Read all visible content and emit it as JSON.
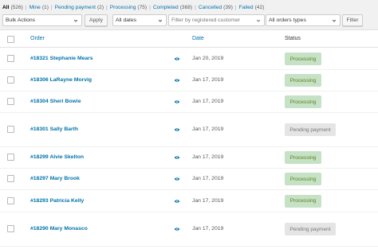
{
  "filters": [
    {
      "label": "All",
      "count": "(526)",
      "current": true
    },
    {
      "label": "Mine",
      "count": "(1)"
    },
    {
      "label": "Pending payment",
      "count": "(2)"
    },
    {
      "label": "Processing",
      "count": "(75)"
    },
    {
      "label": "Completed",
      "count": "(368)"
    },
    {
      "label": "Cancelled",
      "count": "(39)"
    },
    {
      "label": "Failed",
      "count": "(42)"
    }
  ],
  "toolbar": {
    "bulk_actions": "Bulk Actions",
    "apply_label": "Apply",
    "dates": "All dates",
    "customer_placeholder": "Filter by registered customer",
    "order_types": "All orders types",
    "filter_label": "Filter"
  },
  "table": {
    "columns": {
      "order": "Order",
      "date": "Date",
      "status": "Status"
    },
    "rows": [
      {
        "order": "#18321 Stephanie Mears",
        "date": "Jan 20, 2019",
        "status": "Processing",
        "status_key": "processing"
      },
      {
        "order": "#18306 LaRayne Morvig",
        "date": "Jan 17, 2019",
        "status": "Processing",
        "status_key": "processing"
      },
      {
        "order": "#18304 Sheri Bowie",
        "date": "Jan 17, 2019",
        "status": "Processing",
        "status_key": "processing"
      },
      {
        "order": "#18301 Sally Barth",
        "date": "Jan 17, 2019",
        "status": "Pending payment",
        "status_key": "pending"
      },
      {
        "order": "#18299 Alvie Skelton",
        "date": "Jan 17, 2019",
        "status": "Processing",
        "status_key": "processing"
      },
      {
        "order": "#18297 Mary Brook",
        "date": "Jan 17, 2019",
        "status": "Processing",
        "status_key": "processing"
      },
      {
        "order": "#18293 Patricia Kelly",
        "date": "Jan 17, 2019",
        "status": "Processing",
        "status_key": "processing"
      },
      {
        "order": "#18290 Mary Monasco",
        "date": "Jan 17, 2019",
        "status": "Pending payment",
        "status_key": "pending"
      }
    ]
  },
  "icons": {
    "preview": "eye-icon",
    "dropdown": "chevron-down-icon"
  },
  "colors": {
    "link": "#0073aa",
    "processing_bg": "#c6e1c6",
    "processing_text": "#5b841b",
    "pending_bg": "#e5e5e5",
    "pending_text": "#777777"
  }
}
